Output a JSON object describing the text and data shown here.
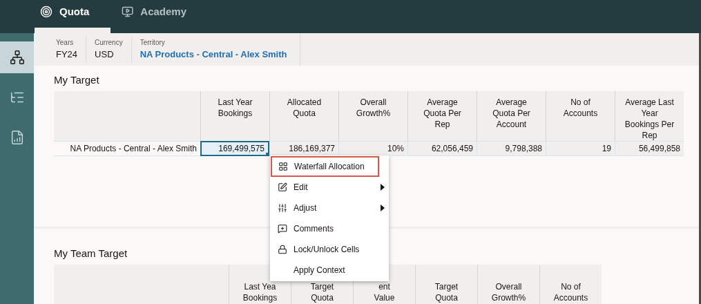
{
  "tabs": [
    {
      "label": "Quota",
      "selected": true
    },
    {
      "label": "Academy",
      "selected": false
    }
  ],
  "sidebar": {
    "items": [
      {
        "selected": true
      },
      {
        "selected": false
      },
      {
        "selected": false
      }
    ]
  },
  "context": [
    {
      "label": "Years",
      "value": "FY24",
      "kind": "plain"
    },
    {
      "label": "Currency",
      "value": "USD",
      "kind": "plain"
    },
    {
      "label": "Territory",
      "value": "NA Products - Central - Alex Smith",
      "kind": "link"
    }
  ],
  "my_target": {
    "title": "My Target",
    "columns": [
      "Last Year\nBookings",
      "Allocated\nQuota",
      "Overall\nGrowth%",
      "Average\nQuota Per\nRep",
      "Average\nQuota Per\nAccount",
      "No of\nAccounts",
      "Average Last\nYear\nBookings Per\nRep"
    ],
    "rows": [
      {
        "label": "NA Products - Central - Alex Smith",
        "cells": [
          {
            "text": "169,499,575",
            "selected": true
          },
          {
            "text": "186,169,377",
            "selected": false
          },
          {
            "text": "10%",
            "selected": false
          },
          {
            "text": "62,056,459",
            "selected": false
          },
          {
            "text": "9,798,388",
            "selected": false
          },
          {
            "text": "19",
            "selected": false
          },
          {
            "text": "56,499,858",
            "selected": false
          }
        ]
      }
    ]
  },
  "my_team_target": {
    "title": "My Team Target",
    "columns": [
      "Last Yea\nBookings",
      "Target\nQuota",
      "ent\nValue",
      "Target\nQuota",
      "Overall\nGrowth%",
      "No of\nAccounts"
    ]
  },
  "context_menu": [
    {
      "label": "Waterfall Allocation",
      "submenu": false,
      "selected": true
    },
    {
      "label": "Edit",
      "submenu": true,
      "selected": false
    },
    {
      "label": "Adjust",
      "submenu": true,
      "selected": false
    },
    {
      "label": "Comments",
      "submenu": false,
      "selected": false
    },
    {
      "label": "Lock/Unlock Cells",
      "submenu": false,
      "selected": false
    },
    {
      "label": "Apply Context",
      "submenu": false,
      "selected": false
    }
  ]
}
